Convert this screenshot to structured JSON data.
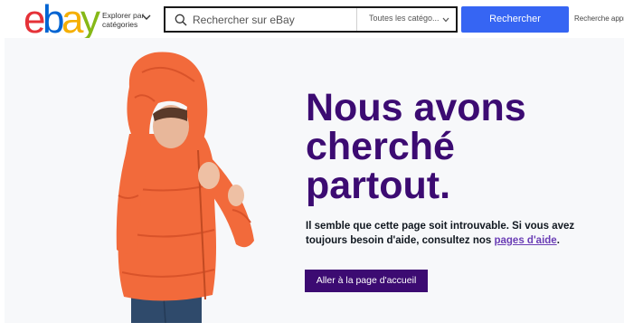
{
  "logo": {
    "letters": [
      "e",
      "b",
      "a",
      "y"
    ],
    "colors": [
      "#e53238",
      "#0064d2",
      "#f5af02",
      "#86b817"
    ]
  },
  "header": {
    "explore_line1": "Explorer par",
    "explore_line2": "catégories",
    "search_placeholder": "Rechercher sur eBay",
    "category_label": "Toutes les catégo...",
    "search_button": "Rechercher",
    "advanced_link": "Recherche appro"
  },
  "hero": {
    "headline": [
      "Nous avons",
      "cherché",
      "partout."
    ],
    "message_before": "Il semble que cette page soit introuvable. Si vous avez toujours besoin d'aide, consultez nos ",
    "help_link": "pages d'aide",
    "message_after": ".",
    "home_button": "Aller à la page d'accueil"
  },
  "colors": {
    "accent_blue": "#3665f3",
    "purple": "#3c0b72",
    "link_purple": "#6a3db5",
    "jacket": "#f26a3b"
  },
  "icons": [
    "search-icon",
    "chevron-down-icon"
  ]
}
